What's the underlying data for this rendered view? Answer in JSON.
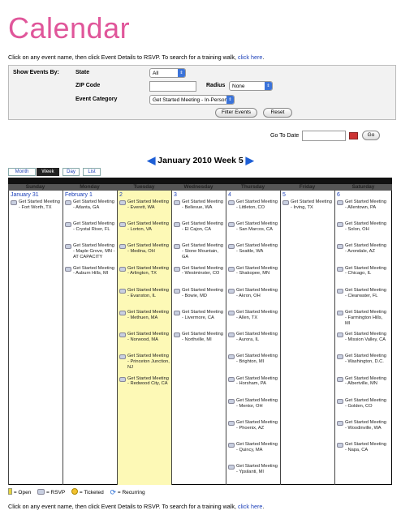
{
  "page": {
    "title": "Calendar",
    "intro_text": "Click on any event name, then click Event Details to RSVP. To search for a training walk,",
    "intro_link": "click here",
    "intro_end": "."
  },
  "filters": {
    "show_events_by": "Show Events By:",
    "state_label": "State",
    "state_value": "All",
    "zip_label": "ZIP Code",
    "zip_value": "",
    "radius_label": "Radius",
    "radius_value": "None",
    "category_label": "Event Category",
    "category_value": "Get Started Meeting - In-Person",
    "filter_button": "Filter Events",
    "reset_button": "Reset"
  },
  "goto": {
    "label": "Go To Date",
    "value": "",
    "button": "Go"
  },
  "week_nav": {
    "title": "January 2010 Week 5"
  },
  "tabs": [
    "Month",
    "Week",
    "Day",
    "List"
  ],
  "active_tab": "Week",
  "calendar": {
    "days": [
      {
        "name": "Sunday",
        "date": "January 31",
        "events": [
          "Get Started Meeting - Fort Worth, TX"
        ]
      },
      {
        "name": "Monday",
        "date": "February 1",
        "events": [
          "Get Started Meeting - Atlanta, GA",
          "Get Started Meeting - Crystal River, FL",
          "Get Started Meeting - Maple Grove, MN - AT CAPACITY",
          "Get Started Meeting - Auburn Hills, MI"
        ]
      },
      {
        "name": "Tuesday",
        "date": "2",
        "events": [
          "Get Started Meeting - Everett, WA",
          "Get Started Meeting - Lorton, VA",
          "Get Started Meeting - Medina, OH",
          "Get Started Meeting - Arlington, TX",
          "Get Started Meeting - Evanston, IL",
          "Get Started Meeting - Methuen, MA",
          "Get Started Meeting - Norwood, MA",
          "Get Started Meeting - Princeton Junction, NJ",
          "Get Started Meeting - Redwood City, CA"
        ]
      },
      {
        "name": "Wednesday",
        "date": "3",
        "events": [
          "Get Started Meeting - Bellevue, WA",
          "Get Started Meeting - El Cajon, CA",
          "Get Started Meeting - Stone Mountain, GA",
          "Get Started Meeting - Westminster, CO",
          "Get Started Meeting - Bowie, MD",
          "Get Started Meeting - Livermore, CA",
          "Get Started Meeting - Northville, MI"
        ]
      },
      {
        "name": "Thursday",
        "date": "4",
        "events": [
          "Get Started Meeting - Littleton, CO",
          "Get Started Meeting - San Marcos, CA",
          "Get Started Meeting - Seattle, WA",
          "Get Started Meeting - Shakopee, MN",
          "Get Started Meeting - Akron, OH",
          "Get Started Meeting - Allen, TX",
          "Get Started Meeting - Aurora, IL",
          "Get Started Meeting - Brighton, MI",
          "Get Started Meeting - Horsham, PA",
          "Get Started Meeting - Mentor, OH",
          "Get Started Meeting - Phoenix, AZ",
          "Get Started Meeting - Quincy, MA",
          "Get Started Meeting - Ypsilanti, MI"
        ]
      },
      {
        "name": "Friday",
        "date": "5",
        "events": [
          "Get Started Meeting - Irving, TX"
        ]
      },
      {
        "name": "Saturday",
        "date": "6",
        "events": [
          "Get Started Meeting - Allentown, PA",
          "Get Started Meeting - Solon, OH",
          "Get Started Meeting - Avondale, AZ",
          "Get Started Meeting - Chicago, IL",
          "Get Started Meeting - Clearwater, FL",
          "Get Started Meeting - Farmington Hills, MI",
          "Get Started Meeting - Mission Valley, CA",
          "Get Started Meeting - Washington, D.C.",
          "Get Started Meeting - Albertville, MN",
          "Get Started Meeting - Golden, CO",
          "Get Started Meeting - Woodinville, WA",
          "Get Started Meeting - Napa, CA"
        ]
      }
    ]
  },
  "legend": {
    "open": "= Open",
    "rsvp": "= RSVP",
    "ticketed": "= Ticketed",
    "recurring": "= Recurring"
  },
  "footer": {
    "text": "Click on any event name, then click Event Details to RSVP. To search for a training walk,",
    "link": "click here",
    "end": "."
  },
  "colors": {
    "title": "#e0569a",
    "link": "#1b3fb8",
    "highlight": "#fdf9b6"
  }
}
